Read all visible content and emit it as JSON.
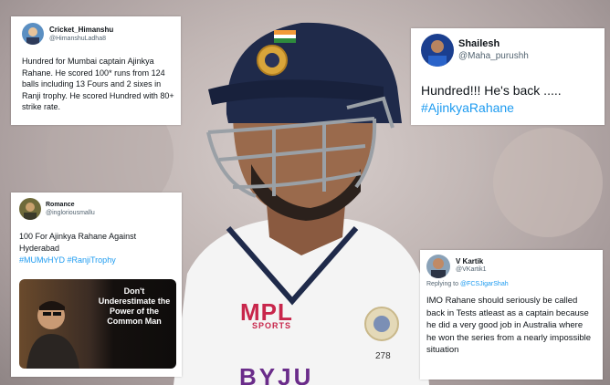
{
  "tweets": [
    {
      "name": "Cricket_Himanshu",
      "handle": "@HimanshuLadha8",
      "text": "Hundred for Mumbai captain Ajinkya Rahane. He scored 100* runs from 124 balls including 13 Fours and 2 sixes in Ranji trophy. He scored Hundred with 80+ strike rate."
    },
    {
      "name": "Shailesh",
      "handle": "@Maha_purushh",
      "text": "Hundred!!! He's back .....",
      "hashtag": "#AjinkyaRahane"
    },
    {
      "name": "Romance",
      "handle": "@ingloriousmallu",
      "text": "100 For Ajinkya Rahane Against Hyderabad",
      "hashtags": "#MUMvHYD #RanjiTrophy",
      "meme_text": "Don't Underestimate the Power of the Common Man"
    },
    {
      "name": "V Kartik",
      "handle": "@VKartik1",
      "reply_prefix": "Replying to",
      "reply_handle": "@FCSJigarShah",
      "text": "IMO Rahane should seriously be called back in Tests atleast as a captain because he did a very good job in Australia where he won the series from a nearly impossible situation"
    }
  ],
  "photo": {
    "jersey_brand": "MPL",
    "jersey_sub": "SPORTS",
    "jersey_number": "278",
    "jersey_bottom": "BYJU"
  },
  "colors": {
    "link": "#1d9bf0",
    "helmet": "#1f2a4a",
    "jersey_brand": "#c8264b",
    "jersey_bottom": "#6a2c8a"
  }
}
